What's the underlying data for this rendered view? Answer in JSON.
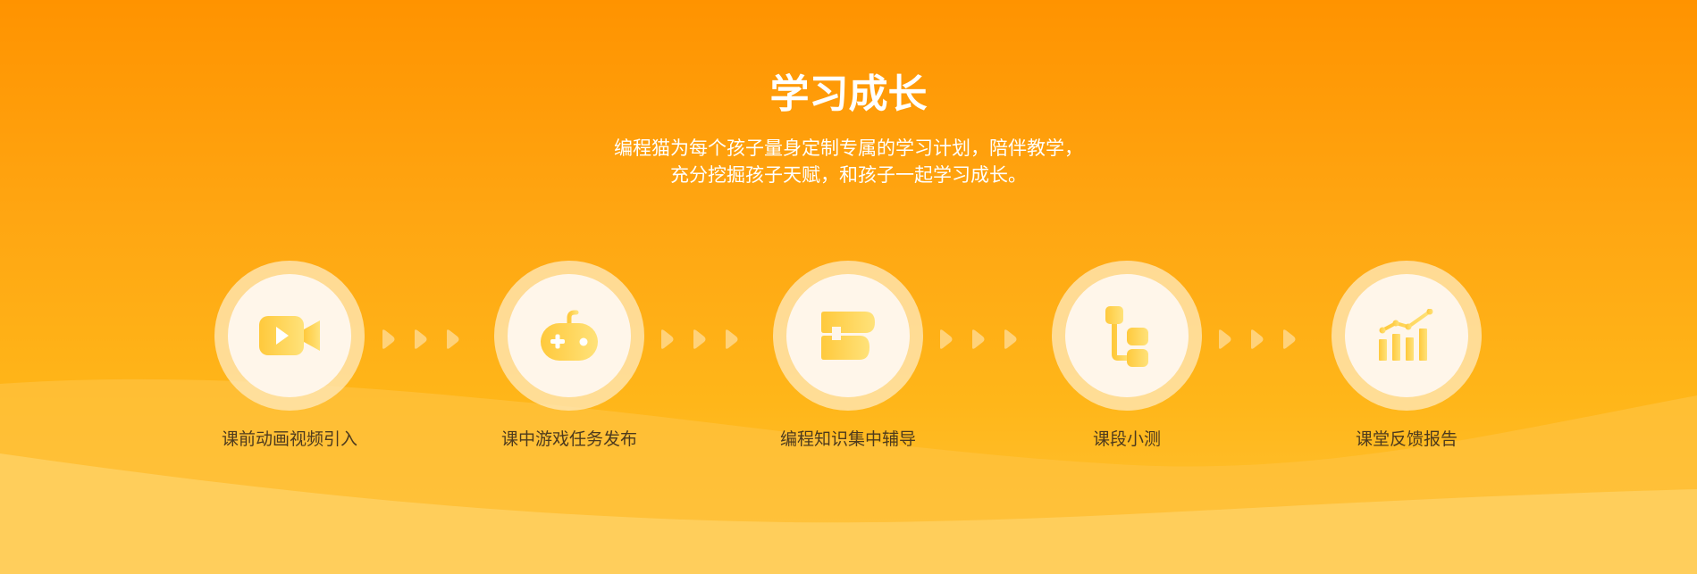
{
  "section": {
    "title": "学习成长",
    "description_line1": "编程猫为每个孩子量身定制专属的学习计划，陪伴教学，",
    "description_line2": "充分挖掘孩子天赋，和孩子一起学习成长。"
  },
  "steps": [
    {
      "label": "课前动画视频引入",
      "icon": "video-camera-icon"
    },
    {
      "label": "课中游戏任务发布",
      "icon": "gamepad-icon"
    },
    {
      "label": "编程知识集中辅导",
      "icon": "code-blocks-icon"
    },
    {
      "label": "课段小测",
      "icon": "flowchart-icon"
    },
    {
      "label": "课堂反馈报告",
      "icon": "bar-chart-icon"
    }
  ],
  "colors": {
    "background_top": "#ff9300",
    "background_bottom": "#ffc53a",
    "icon_gradient_start": "#ffc93c",
    "icon_gradient_end": "#ffe27a",
    "circle_inner": "#fff6ea",
    "label_text": "#4d3a1d"
  }
}
